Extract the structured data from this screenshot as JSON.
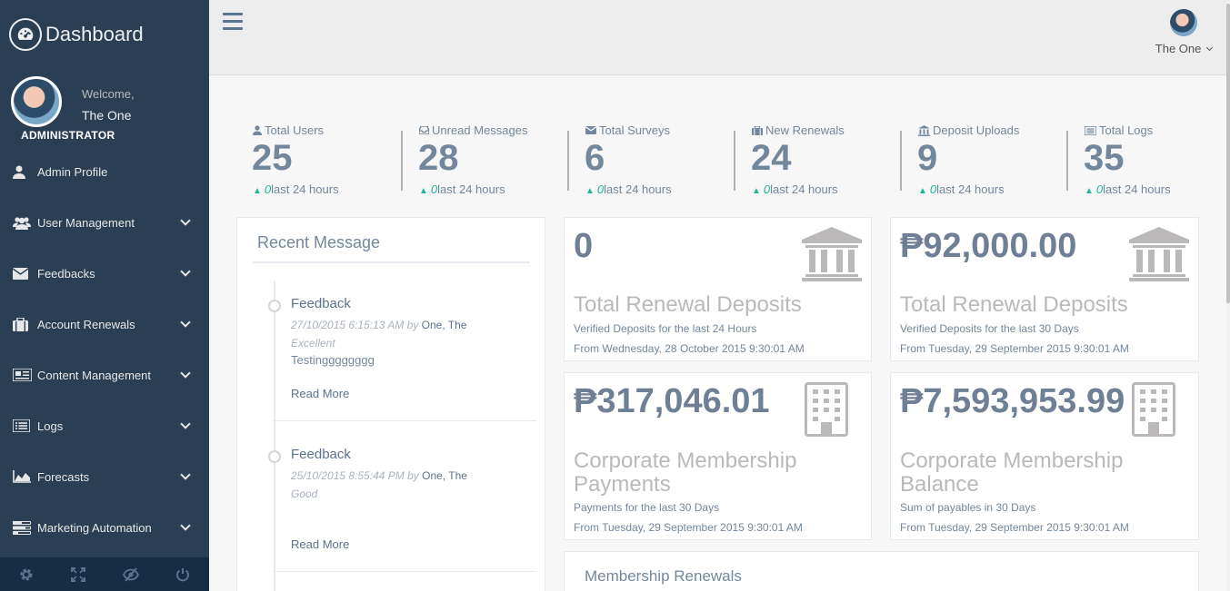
{
  "sidebar": {
    "brand": "Dashboard",
    "welcome": "Welcome,",
    "user_name": "The One",
    "role": "ADMINISTRATOR",
    "items": [
      {
        "label": "Admin Profile",
        "icon": "user-icon"
      },
      {
        "label": "User Management",
        "icon": "users-icon"
      },
      {
        "label": "Feedbacks",
        "icon": "envelope-icon"
      },
      {
        "label": "Account Renewals",
        "icon": "briefcase-icon"
      },
      {
        "label": "Content Management",
        "icon": "newspaper-icon"
      },
      {
        "label": "Logs",
        "icon": "list-icon"
      },
      {
        "label": "Forecasts",
        "icon": "area-chart-icon"
      },
      {
        "label": "Marketing Automation",
        "icon": "tasks-icon"
      }
    ],
    "footer_icons": [
      "gear-icon",
      "fullscreen-icon",
      "eye-slash-icon",
      "power-icon"
    ]
  },
  "topnav": {
    "user_name": "The One"
  },
  "stats": [
    {
      "label": "Total Users",
      "value": "25",
      "delta": "0",
      "delta_label": "last 24 hours",
      "icon": "user-icon"
    },
    {
      "label": "Unread Messages",
      "value": "28",
      "delta": "0",
      "delta_label": "last 24 hours",
      "icon": "inbox-icon"
    },
    {
      "label": "Total Surveys",
      "value": "6",
      "delta": "0",
      "delta_label": "last 24 hours",
      "icon": "envelope-icon"
    },
    {
      "label": "New Renewals",
      "value": "24",
      "delta": "0",
      "delta_label": "last 24 hours",
      "icon": "briefcase-icon"
    },
    {
      "label": "Deposit Uploads",
      "value": "9",
      "delta": "0",
      "delta_label": "last 24 hours",
      "icon": "bank-icon"
    },
    {
      "label": "Total Logs",
      "value": "35",
      "delta": "0",
      "delta_label": "last 24 hours",
      "icon": "list-alt-icon"
    }
  ],
  "recent": {
    "title": "Recent Message",
    "items": [
      {
        "title": "Feedback",
        "meta_prefix": "27/10/2015 6:15:13 AM by ",
        "meta_name": "One, The",
        "meta_suffix": "Excellent",
        "body": "Testingggggggg",
        "more": "Read More"
      },
      {
        "title": "Feedback",
        "meta_prefix": "25/10/2015 8:55:44 PM by ",
        "meta_name": "One, The",
        "meta_suffix": "Good",
        "body": "",
        "more": "Read More"
      }
    ]
  },
  "tiles": [
    {
      "value": "0",
      "title": "Total Renewal Deposits",
      "sub1": "Verified Deposits for the last 24 Hours",
      "sub2": "From Wednesday, 28 October 2015 9:30:01 AM",
      "icon": "bank-icon"
    },
    {
      "value": "₱92,000.00",
      "title": "Total Renewal Deposits",
      "sub1": "Verified Deposits for the last 30 Days",
      "sub2": "From Tuesday, 29 September 2015 9:30:01 AM",
      "icon": "bank-icon"
    },
    {
      "value": "₱317,046.01",
      "title": "Corporate Membership Payments",
      "sub1": "Payments for the last 30 Days",
      "sub2": "From Tuesday, 29 September 2015 9:30:01 AM",
      "icon": "building-icon"
    },
    {
      "value": "₱7,593,953.99",
      "title": "Corporate Membership Balance",
      "sub1": "Sum of payables in 30 Days",
      "sub2": "From Tuesday, 29 September 2015 9:30:01 AM",
      "icon": "building-icon"
    }
  ],
  "renewals": {
    "title": "Membership Renewals"
  },
  "colors": {
    "sidebar_bg": "#2a3f54",
    "accent_green": "#1abb9c",
    "text": "#73879c"
  }
}
